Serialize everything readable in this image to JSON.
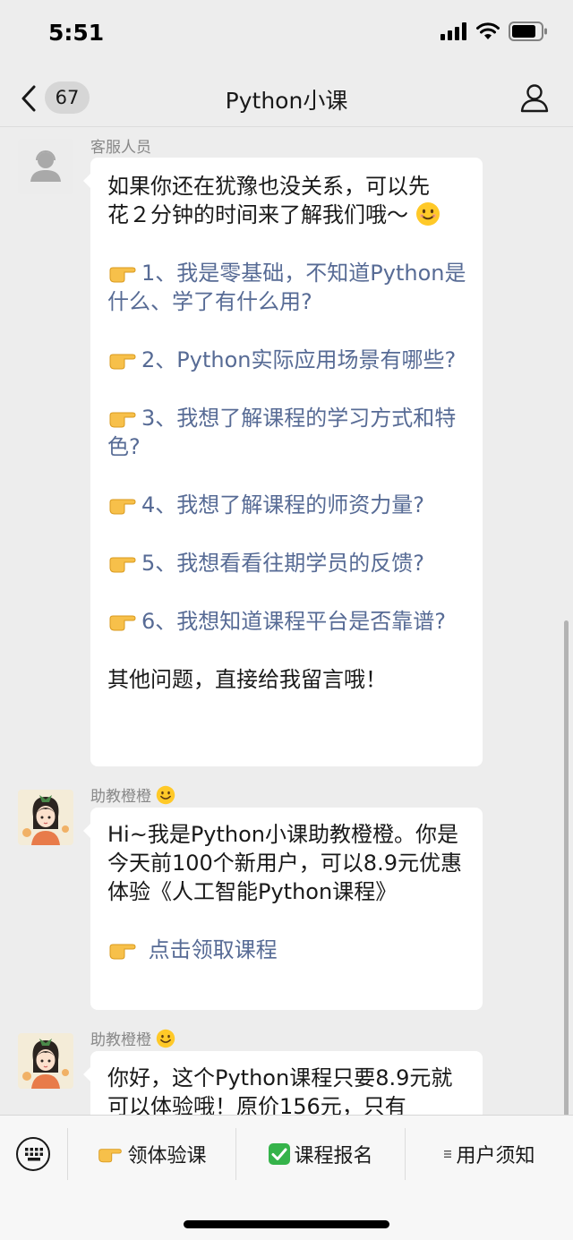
{
  "status_bar": {
    "time": "5:51"
  },
  "nav": {
    "unread_count": "67",
    "title": "Python小课"
  },
  "messages": [
    {
      "sender": "客服人员",
      "intro_line1": "如果你还在犹豫也没关系，可以先",
      "intro_line2": "花２分钟的时间来了解我们哦～",
      "options": [
        "1、我是零基础，不知道Python是什么、学了有什么用?",
        "2、Python实际应用场景有哪些?",
        "3、我想了解课程的学习方式和特色?",
        "4、我想了解课程的师资力量?",
        "5、我想看看往期学员的反馈?",
        "6、我想知道课程平台是否靠谱?"
      ],
      "outro": "其他问题，直接给我留言哦！"
    },
    {
      "sender": "助教橙橙",
      "text": "Hi~我是Python小课助教橙橙。你是今天前100个新用户，可以8.9元优惠体验《人工智能Python课程》",
      "link": "点击领取课程"
    },
    {
      "sender": "助教橙橙",
      "text": "你好，这个Python课程只要8.9元就可以体验哦！原价156元，只有"
    }
  ],
  "menu": {
    "item1": "领体验课",
    "item2": "课程报名",
    "item3": "用户须知"
  },
  "icons": {
    "back": "chevron-left-icon",
    "profile": "person-icon",
    "keyboard": "keyboard-icon",
    "pointer": "pointing-hand-emoji",
    "smile": "smiling-face-emoji",
    "check": "check-mark-emoji"
  },
  "colors": {
    "link": "#576b95",
    "background": "#ededed",
    "bubble": "#ffffff"
  }
}
